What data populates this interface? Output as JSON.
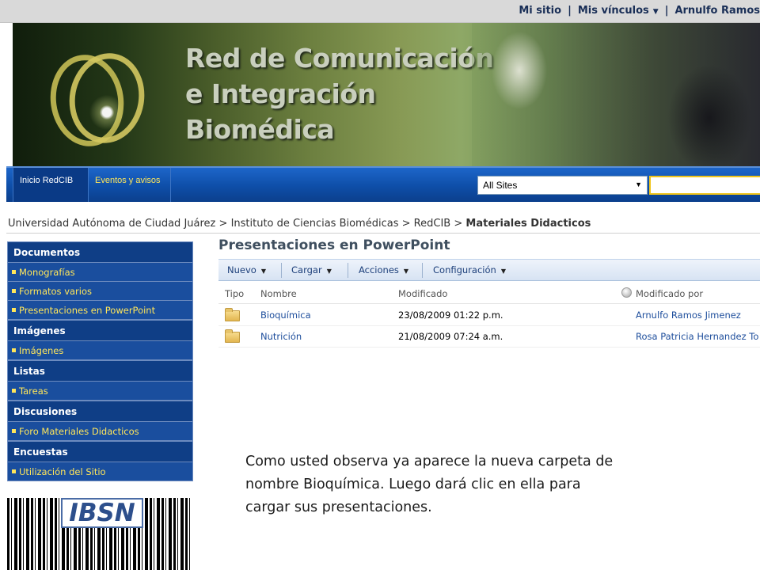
{
  "topbar": {
    "my_site": "Mi sitio",
    "my_links": "Mis vínculos",
    "user": "Arnulfo Ramos"
  },
  "banner": {
    "title_line1": "Red de Comunicación",
    "title_line2": "e Integración",
    "title_line3": "Biomédica"
  },
  "nav": {
    "tabs": [
      {
        "label": "Inicio RedCIB"
      },
      {
        "label": "Eventos y avisos"
      }
    ],
    "search_scope": "All Sites"
  },
  "breadcrumb": {
    "items": [
      "Universidad Autónoma de Ciudad Juárez",
      "Instituto de Ciencias Biomédicas",
      "RedCIB"
    ],
    "separator": ">",
    "current": "Materiales Didacticos"
  },
  "sidebar": {
    "sections": [
      {
        "heading": "Documentos",
        "items": [
          "Monografías",
          "Formatos varios",
          "Presentaciones en PowerPoint"
        ]
      },
      {
        "heading": "Imágenes",
        "items": [
          "Imágenes"
        ]
      },
      {
        "heading": "Listas",
        "items": [
          "Tareas"
        ]
      },
      {
        "heading": "Discusiones",
        "items": [
          "Foro Materiales Didacticos"
        ]
      },
      {
        "heading": "Encuestas",
        "items": [
          "Utilización del Sitio"
        ]
      }
    ]
  },
  "logo": {
    "text": "IBSN"
  },
  "main": {
    "title": "Presentaciones en PowerPoint",
    "toolbar": {
      "new": "Nuevo",
      "upload": "Cargar",
      "actions": "Acciones",
      "settings": "Configuración"
    },
    "columns": {
      "type": "Tipo",
      "name": "Nombre",
      "modified": "Modificado",
      "modified_by": "Modificado por"
    },
    "rows": [
      {
        "name": "Bioquímica",
        "modified": "23/08/2009 01:22 p.m.",
        "modified_by": "Arnulfo Ramos Jimenez"
      },
      {
        "name": "Nutrición",
        "modified": "21/08/2009 07:24 a.m.",
        "modified_by": "Rosa Patricia Hernandez To"
      }
    ]
  },
  "caption": "Como usted observa ya aparece la nueva carpeta de nombre Bioquímica. Luego dará clic en ella para cargar sus presentaciones.",
  "colors": {
    "nav_blue": "#0e4ea8",
    "sidebar_heading": "#0f3e86",
    "sidebar_item": "#1a4e9e",
    "accent_yellow": "#ffe65a",
    "link_blue": "#1e4e9c"
  }
}
